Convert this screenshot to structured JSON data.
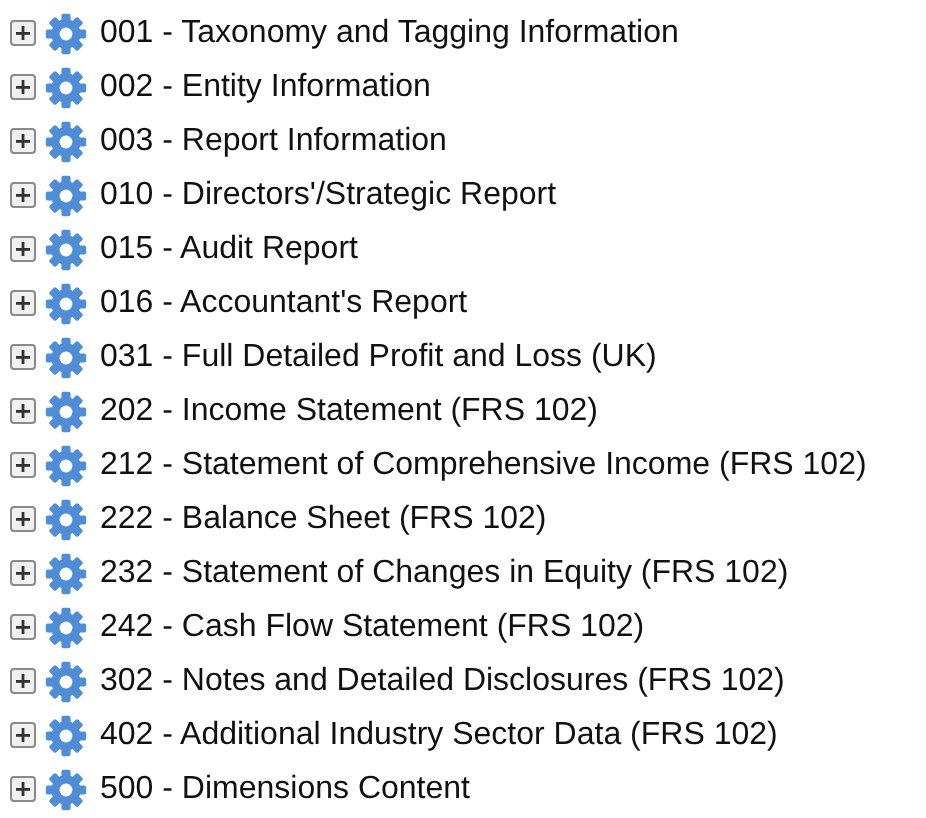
{
  "tree": [
    {
      "label": "001 - Taxonomy and Tagging Information",
      "expanded": false
    },
    {
      "label": "002 - Entity Information",
      "expanded": false
    },
    {
      "label": "003 - Report Information",
      "expanded": false
    },
    {
      "label": "010 - Directors'/Strategic Report",
      "expanded": false
    },
    {
      "label": "015 - Audit Report",
      "expanded": false
    },
    {
      "label": "016 - Accountant's Report",
      "expanded": false
    },
    {
      "label": "031 - Full Detailed Profit and Loss (UK)",
      "expanded": false
    },
    {
      "label": "202 - Income Statement (FRS 102)",
      "expanded": false
    },
    {
      "label": "212 - Statement of Comprehensive Income (FRS 102)",
      "expanded": false
    },
    {
      "label": "222 - Balance Sheet (FRS 102)",
      "expanded": false
    },
    {
      "label": "232 - Statement of Changes in Equity (FRS 102)",
      "expanded": false
    },
    {
      "label": "242 - Cash Flow Statement (FRS 102)",
      "expanded": false
    },
    {
      "label": "302 - Notes and Detailed Disclosures (FRS 102)",
      "expanded": false
    },
    {
      "label": "402 - Additional Industry Sector Data (FRS 102)",
      "expanded": false
    },
    {
      "label": "500 - Dimensions Content",
      "expanded": false
    }
  ]
}
